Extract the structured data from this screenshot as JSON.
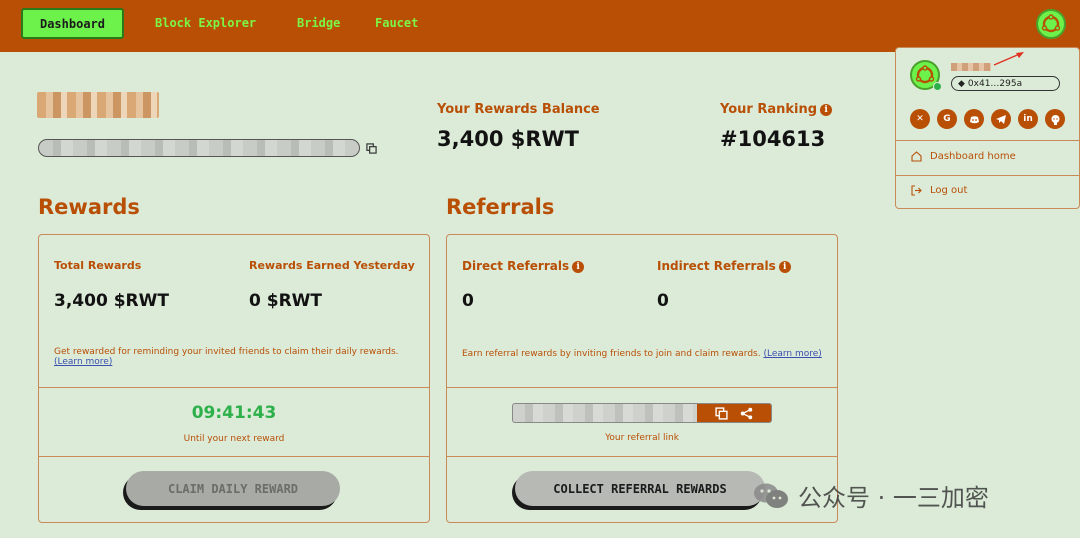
{
  "nav": {
    "dashboard": "Dashboard",
    "links": [
      "Block Explorer",
      "Bridge",
      "Faucet"
    ]
  },
  "stats": {
    "balance_label": "Your Rewards Balance",
    "balance_value": "3,400 $RWT",
    "ranking_label": "Your Ranking",
    "ranking_value": "#104613"
  },
  "rewards": {
    "title": "Rewards",
    "total_label": "Total Rewards",
    "total_value": "3,400 $RWT",
    "yesterday_label": "Rewards Earned Yesterday",
    "yesterday_value": "0 $RWT",
    "desc": "Get rewarded for reminding your invited friends to claim their daily rewards.",
    "learn_more": "(Learn more)",
    "timer": "09:41:43",
    "timer_sub": "Until your next reward",
    "claim_button": "CLAIM DAILY REWARD"
  },
  "referrals": {
    "title": "Referrals",
    "direct_label": "Direct Referrals",
    "direct_value": "0",
    "indirect_label": "Indirect Referrals",
    "indirect_value": "0",
    "desc": "Earn referral rewards by inviting friends to join and claim rewards.",
    "learn_more": "(Learn more)",
    "link_sub": "Your referral link",
    "collect_button": "COLLECT REFERRAL REWARDS"
  },
  "dropdown": {
    "address": "0x41…295a",
    "socials": [
      "x-icon",
      "google-icon",
      "discord-icon",
      "telegram-icon",
      "linkedin-icon",
      "github-icon"
    ],
    "dashboard_home": "Dashboard home",
    "log_out": "Log out"
  },
  "watermark": {
    "text": "公众号 · 一三加密"
  },
  "colors": {
    "nav_bg": "#b84f05",
    "page_bg": "#dcebd8",
    "accent_green": "#6cf24a",
    "timer_green": "#2db04a"
  }
}
